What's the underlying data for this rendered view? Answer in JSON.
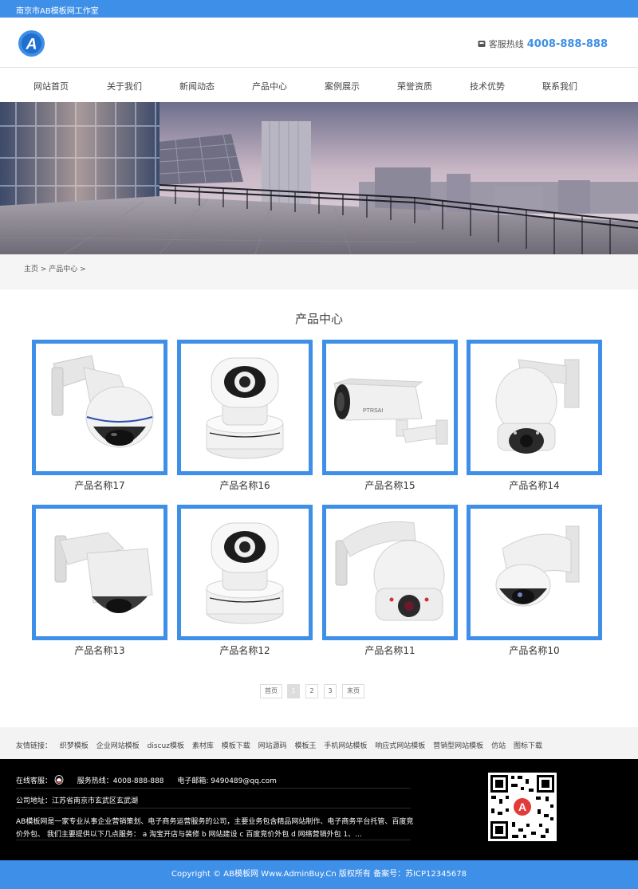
{
  "topbar": {
    "title": "南京市AB模板网工作室"
  },
  "header": {
    "hotline_label": "客服热线",
    "hotline_number": "4008-888-888",
    "logo_letter": "A"
  },
  "nav": {
    "items": [
      "网站首页",
      "关于我们",
      "新闻动态",
      "产品中心",
      "案例展示",
      "荣誉资质",
      "技术优势",
      "联系我们"
    ]
  },
  "breadcrumb": {
    "text": "主页 > 产品中心 >"
  },
  "products": {
    "title": "产品中心",
    "items": [
      {
        "name": "产品名称17"
      },
      {
        "name": "产品名称16"
      },
      {
        "name": "产品名称15"
      },
      {
        "name": "产品名称14"
      },
      {
        "name": "产品名称13"
      },
      {
        "name": "产品名称12"
      },
      {
        "name": "产品名称11"
      },
      {
        "name": "产品名称10"
      }
    ]
  },
  "pagination": {
    "first": "首页",
    "pages": [
      "1",
      "2",
      "3"
    ],
    "last": "末页",
    "current": "1"
  },
  "links": {
    "label": "友情链接：",
    "items": [
      "织梦模板",
      "企业网站模板",
      "discuz模板",
      "素材库",
      "模板下载",
      "网站源码",
      "模板王",
      "手机网站模板",
      "响应式网站模板",
      "营销型网站模板",
      "仿站",
      "图标下载"
    ]
  },
  "footer": {
    "online_service": "在线客服：",
    "service_hotline": "服务热线：4008-888-888",
    "email": "电子邮箱: 9490489@qq.com",
    "address": "公司地址：江苏省南京市玄武区玄武湖",
    "desc_line1": "AB模板网是一家专业从事企业营销策划、电子商务运营服务的公司，主要业务包含精品网站制作、电子商务平台托管、百度竞",
    "desc_line2": "价外包、 我们主要提供以下几点服务： a 淘宝开店与装修 b 网站建设 c 百度竞价外包 d 网络营销外包 1、..."
  },
  "copyright": {
    "text": "Copyright © AB模板网 Www.AdminBuy.Cn 版权所有  备案号：苏ICP12345678"
  },
  "colors": {
    "accent": "#3e8fe8",
    "footer_bg": "#000000"
  }
}
